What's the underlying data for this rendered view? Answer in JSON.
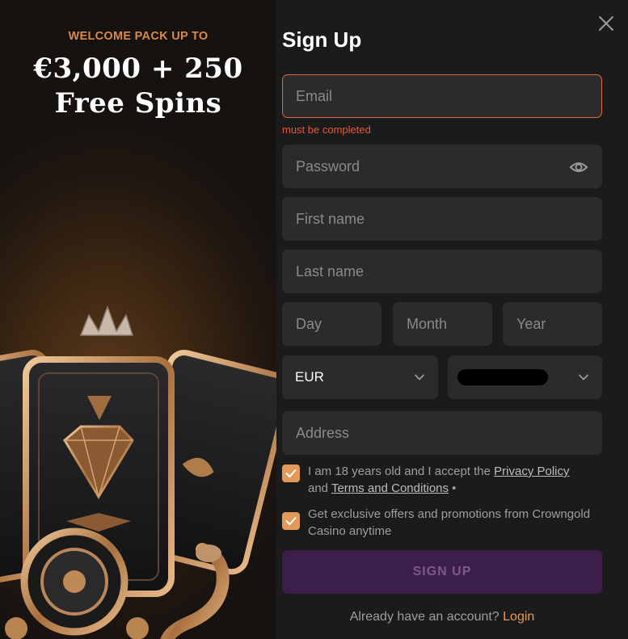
{
  "promo": {
    "kicker": "WELCOME PACK UP TO",
    "line1": "€3,000 + 250",
    "line2": "Free Spins"
  },
  "form": {
    "title": "Sign Up",
    "email_placeholder": "Email",
    "email_error": "must be completed",
    "password_placeholder": "Password",
    "first_name_placeholder": "First name",
    "last_name_placeholder": "Last name",
    "day_placeholder": "Day",
    "month_placeholder": "Month",
    "year_placeholder": "Year",
    "currency_value": "EUR",
    "address_placeholder": "Address",
    "consent_age_prefix": "I am 18 years old and I accept the ",
    "privacy_link": "Privacy Policy",
    "consent_and": "and ",
    "terms_link": "Terms and Conditions",
    "required_mark": " •",
    "consent_offers": "Get exclusive offers and promotions from Crowngold Casino anytime",
    "submit_label": "SIGN UP",
    "login_prompt": "Already have an account? ",
    "login_link": "Login"
  },
  "colors": {
    "accent": "#e29a5b",
    "error": "#e55a3c",
    "button_bg": "#3b1e4a",
    "field_bg": "#2b2b2b"
  },
  "icons": {
    "close": "close-icon",
    "eye": "eye-icon",
    "chevron": "chevron-down-icon",
    "check": "checkmark-icon"
  }
}
